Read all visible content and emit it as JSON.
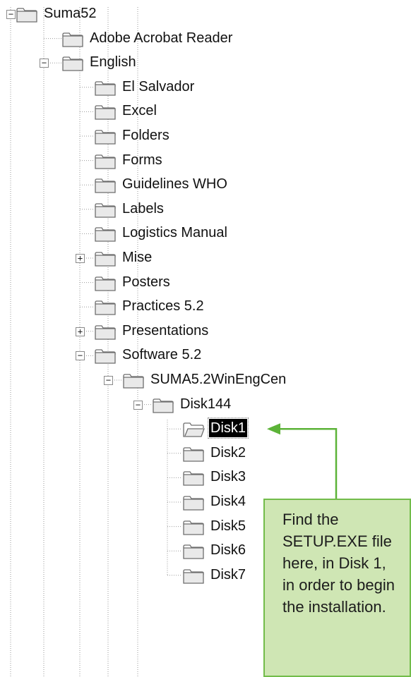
{
  "tree": {
    "nodes": [
      {
        "label": "Suma52",
        "expander": "minus"
      },
      {
        "label": "Adobe Acrobat Reader",
        "expander": ""
      },
      {
        "label": "English",
        "expander": "minus"
      },
      {
        "label": "El Salvador",
        "expander": ""
      },
      {
        "label": "Excel",
        "expander": ""
      },
      {
        "label": "Folders",
        "expander": ""
      },
      {
        "label": "Forms",
        "expander": ""
      },
      {
        "label": "Guidelines WHO",
        "expander": ""
      },
      {
        "label": "Labels",
        "expander": ""
      },
      {
        "label": "Logistics Manual",
        "expander": ""
      },
      {
        "label": "Mise",
        "expander": "plus"
      },
      {
        "label": "Posters",
        "expander": ""
      },
      {
        "label": "Practices 5.2",
        "expander": ""
      },
      {
        "label": "Presentations",
        "expander": "plus"
      },
      {
        "label": "Software 5.2",
        "expander": "minus"
      },
      {
        "label": "SUMA5.2WinEngCen",
        "expander": "minus"
      },
      {
        "label": "Disk144",
        "expander": "minus"
      },
      {
        "label": "Disk1",
        "expander": "",
        "selected": true,
        "open": true
      },
      {
        "label": "Disk2",
        "expander": ""
      },
      {
        "label": "Disk3",
        "expander": ""
      },
      {
        "label": "Disk4",
        "expander": ""
      },
      {
        "label": "Disk5",
        "expander": ""
      },
      {
        "label": "Disk6",
        "expander": ""
      },
      {
        "label": "Disk7",
        "expander": ""
      }
    ]
  },
  "callout": {
    "text": "Find the SETUP.EXE file here, in Disk 1, in order to begin the installation."
  },
  "colors": {
    "callout_fill": "#cfe6b4",
    "callout_border": "#72bc4a",
    "arrow": "#5cb338",
    "folder_fill": "#e9e9e9",
    "folder_stroke": "#6e6e6e",
    "tree_lines": "#9a9a9a"
  },
  "icons": {
    "folder": "folder-icon",
    "open_folder": "open-folder-icon",
    "expand": "plus-box-icon",
    "collapse": "minus-box-icon"
  }
}
